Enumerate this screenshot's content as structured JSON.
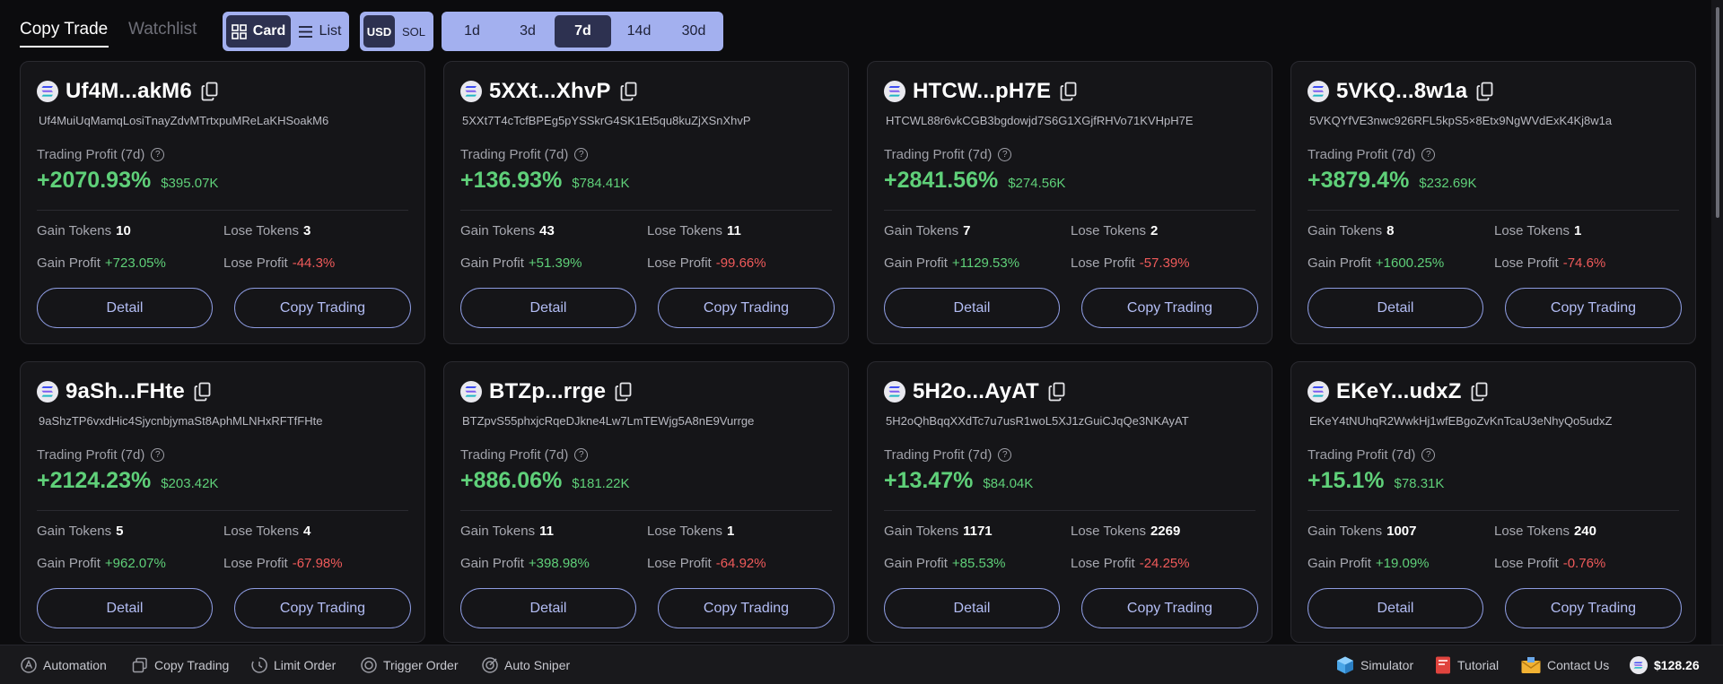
{
  "tabs": {
    "copy_trade": "Copy Trade",
    "watchlist": "Watchlist"
  },
  "view_toggle": {
    "card": "Card",
    "list": "List",
    "selected": "Card"
  },
  "currency_toggle": {
    "usd": "USD",
    "sol": "SOL",
    "selected": "USD"
  },
  "periods": {
    "options": [
      "1d",
      "3d",
      "7d",
      "14d",
      "30d"
    ],
    "selected": "7d"
  },
  "labels": {
    "trading_profit": "Trading Profit (7d)",
    "gain_tokens": "Gain Tokens",
    "lose_tokens": "Lose Tokens",
    "gain_profit": "Gain Profit",
    "lose_profit": "Lose Profit",
    "detail": "Detail",
    "copy_trading": "Copy Trading"
  },
  "cards": [
    {
      "name": "Uf4M...akM6",
      "address": "Uf4MuiUqMamqLosiTnayZdvMTrtxpuMReLaKHSoakM6",
      "profit_pct": "+2070.93%",
      "profit_usd": "$395.07K",
      "gain_tokens": "10",
      "lose_tokens": "3",
      "gain_profit": "+723.05%",
      "lose_profit": "-44.3%"
    },
    {
      "name": "5XXt...XhvP",
      "address": "5XXt7T4cTcfBPEg5pYSSkrG4SK1Et5qu8kuZjXSnXhvP",
      "profit_pct": "+136.93%",
      "profit_usd": "$784.41K",
      "gain_tokens": "43",
      "lose_tokens": "11",
      "gain_profit": "+51.39%",
      "lose_profit": "-99.66%"
    },
    {
      "name": "HTCW...pH7E",
      "address": "HTCWL88r6vkCGB3bgdowjd7S6G1XGjfRHVo71KVHpH7E",
      "profit_pct": "+2841.56%",
      "profit_usd": "$274.56K",
      "gain_tokens": "7",
      "lose_tokens": "2",
      "gain_profit": "+1129.53%",
      "lose_profit": "-57.39%"
    },
    {
      "name": "5VKQ...8w1a",
      "address": "5VKQYfVE3nwc926RFL5kpS5×8Etx9NgWVdExK4Kj8w1a",
      "profit_pct": "+3879.4%",
      "profit_usd": "$232.69K",
      "gain_tokens": "8",
      "lose_tokens": "1",
      "gain_profit": "+1600.25%",
      "lose_profit": "-74.6%"
    },
    {
      "name": "9aSh...FHte",
      "address": "9aShzTP6vxdHic4SjycnbjymaSt8AphMLNHxRFTfFHte",
      "profit_pct": "+2124.23%",
      "profit_usd": "$203.42K",
      "gain_tokens": "5",
      "lose_tokens": "4",
      "gain_profit": "+962.07%",
      "lose_profit": "-67.98%"
    },
    {
      "name": "BTZp...rrge",
      "address": "BTZpvS55phxjcRqeDJkne4Lw7LmTEWjg5A8nE9Vurrge",
      "profit_pct": "+886.06%",
      "profit_usd": "$181.22K",
      "gain_tokens": "11",
      "lose_tokens": "1",
      "gain_profit": "+398.98%",
      "lose_profit": "-64.92%"
    },
    {
      "name": "5H2o...AyAT",
      "address": "5H2oQhBqqXXdTc7u7usR1woL5XJ1zGuiCJqQe3NKAyAT",
      "profit_pct": "+13.47%",
      "profit_usd": "$84.04K",
      "gain_tokens": "1171",
      "lose_tokens": "2269",
      "gain_profit": "+85.53%",
      "lose_profit": "-24.25%"
    },
    {
      "name": "EKeY...udxZ",
      "address": "EKeY4tNUhqR2WwkHj1wfEBgoZvKnTcaU3eNhyQo5udxZ",
      "profit_pct": "+15.1%",
      "profit_usd": "$78.31K",
      "gain_tokens": "1007",
      "lose_tokens": "240",
      "gain_profit": "+19.09%",
      "lose_profit": "-0.76%"
    }
  ],
  "bottom_bar": {
    "automation": "Automation",
    "copy_trading": "Copy Trading",
    "limit_order": "Limit Order",
    "trigger_order": "Trigger Order",
    "auto_sniper": "Auto Sniper",
    "simulator": "Simulator",
    "tutorial": "Tutorial",
    "contact_us": "Contact Us",
    "balance": "$128.26"
  },
  "icons": {
    "card_view": "grid-icon",
    "list_view": "list-icon",
    "chain": "solana-icon",
    "copy": "copy-icon",
    "help": "question-icon",
    "automation": "automation-icon",
    "copy_trading": "copy-trading-icon",
    "limit_order": "limit-order-icon",
    "trigger_order": "trigger-order-icon",
    "auto_sniper": "target-icon",
    "simulator": "cube-icon",
    "tutorial": "book-icon",
    "contact_us": "mail-icon",
    "wallet": "solana-icon"
  },
  "colors": {
    "accent": "#a3b0ef",
    "positive": "#5fd079",
    "negative": "#ef5a5a",
    "background": "#0c0c0e",
    "card": "#151518"
  }
}
